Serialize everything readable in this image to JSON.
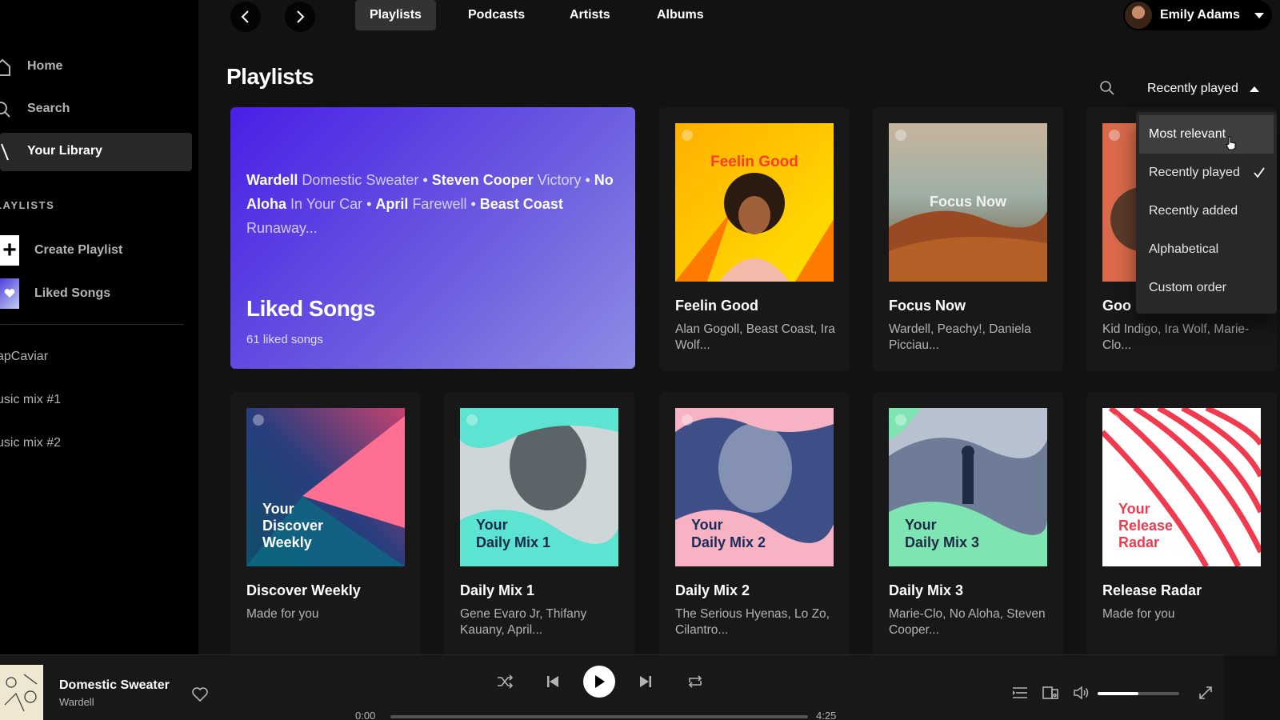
{
  "sidebar": {
    "nav": [
      {
        "label": "Home",
        "icon": "home-icon"
      },
      {
        "label": "Search",
        "icon": "search-icon"
      },
      {
        "label": "Your Library",
        "icon": "library-icon"
      }
    ],
    "playlists_heading": "LAYLISTS",
    "create_label": "Create Playlist",
    "liked_label": "Liked Songs",
    "playlists": [
      "apCaviar",
      "usic mix #1",
      "usic mix #2"
    ]
  },
  "header": {
    "tabs": [
      "Playlists",
      "Podcasts",
      "Artists",
      "Albums"
    ],
    "active_tab": "Playlists",
    "user_name": "Emily Adams"
  },
  "main": {
    "title": "Playlists",
    "sort_label": "Recently played",
    "liked_card": {
      "preview": [
        {
          "artist": "Wardell",
          "song": "Domestic Sweater"
        },
        {
          "artist": "Steven Cooper",
          "song": "Victory"
        },
        {
          "artist": "No Aloha",
          "song": "In Your Car"
        },
        {
          "artist": "April",
          "song": "Farewell"
        },
        {
          "artist": "Beast Coast",
          "song": "Runaway..."
        }
      ],
      "title": "Liked Songs",
      "count": "61 liked songs"
    },
    "cards": [
      {
        "title": "Feelin Good",
        "subtitle": "Alan Gogoll, Beast Coast, Ira Wolf...",
        "cover_text": "Feelin Good"
      },
      {
        "title": "Focus Now",
        "subtitle": "Wardell, Peachy!, Daniela Picciau...",
        "cover_text": "Focus Now"
      },
      {
        "title": "Goo",
        "subtitle": "Kid Indigo, Ira Wolf, Marie-Clo..."
      },
      {
        "title": "Discover Weekly",
        "subtitle": "Made for you",
        "cover_text": [
          "Your",
          "Discover",
          "Weekly"
        ]
      },
      {
        "title": "Daily Mix 1",
        "subtitle": "Gene Evaro Jr, Thifany Kauany, April...",
        "cover_text": [
          "Your",
          "Daily Mix 1"
        ]
      },
      {
        "title": "Daily Mix 2",
        "subtitle": "The Serious Hyenas, Lo Zo, Cilantro...",
        "cover_text": [
          "Your",
          "Daily Mix 2"
        ]
      },
      {
        "title": "Daily Mix 3",
        "subtitle": "Marie-Clo, No Aloha, Steven Cooper...",
        "cover_text": [
          "Your",
          "Daily Mix 3"
        ]
      },
      {
        "title": "Release Radar",
        "subtitle": "Made for you",
        "cover_text": [
          "Your",
          "Release",
          "Radar"
        ]
      }
    ],
    "sort_menu": {
      "options": [
        "Most relevant",
        "Recently played",
        "Recently added",
        "Alphabetical",
        "Custom order"
      ],
      "selected": "Recently played",
      "hovered": "Most relevant"
    }
  },
  "player": {
    "track_title": "Domestic Sweater",
    "track_artist": "Wardell",
    "time_elapsed": "0:00",
    "time_total": "4:25",
    "progress": 0,
    "volume": 0.5
  },
  "colors": {
    "background": "#121212",
    "sidebar": "#000000",
    "card": "#181818",
    "liked_gradient_start": "#4a1fe6",
    "liked_gradient_end": "#8d8ce4",
    "accent_text": "#b3b3b3"
  }
}
